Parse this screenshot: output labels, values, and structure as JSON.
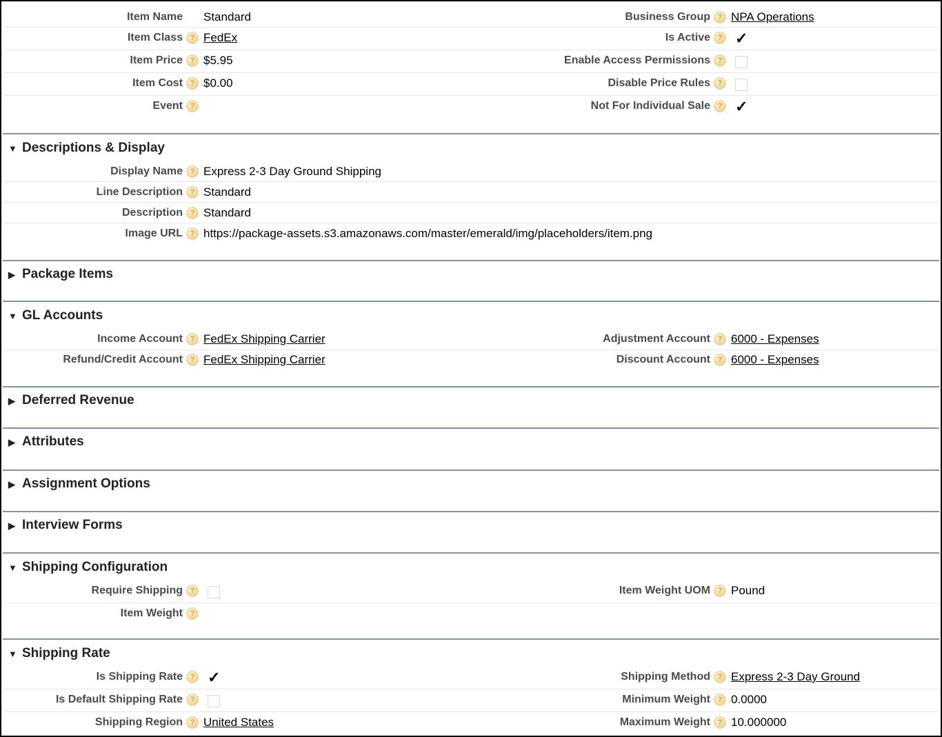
{
  "help_glyph": "?",
  "check_glyph": "✓",
  "triangle_expanded": "▼",
  "triangle_collapsed": "▶",
  "general": {
    "item_name_label": "Item Name",
    "item_name_value": "Standard",
    "item_class_label": "Item Class",
    "item_class_value": "FedEx",
    "item_price_label": "Item Price",
    "item_price_value": "$5.95",
    "item_cost_label": "Item Cost",
    "item_cost_value": "$0.00",
    "event_label": "Event",
    "business_group_label": "Business Group",
    "business_group_value": "NPA Operations",
    "is_active_label": "Is Active",
    "is_active_checked": true,
    "enable_access_label": "Enable Access Permissions",
    "enable_access_checked": false,
    "disable_price_rules_label": "Disable Price Rules",
    "disable_price_rules_checked": false,
    "not_individual_label": "Not For Individual Sale",
    "not_individual_checked": true
  },
  "descriptions": {
    "title": "Descriptions & Display",
    "display_name_label": "Display Name",
    "display_name_value": "Express 2-3 Day Ground Shipping",
    "line_description_label": "Line Description",
    "line_description_value": "Standard",
    "description_label": "Description",
    "description_value": "Standard",
    "image_url_label": "Image URL",
    "image_url_value": "https://package-assets.s3.amazonaws.com/master/emerald/img/placeholders/item.png"
  },
  "package_items": {
    "title": "Package Items"
  },
  "gl_accounts": {
    "title": "GL Accounts",
    "income_label": "Income Account",
    "income_value": "FedEx Shipping Carrier",
    "refund_label": "Refund/Credit Account",
    "refund_value": "FedEx Shipping Carrier",
    "adjustment_label": "Adjustment Account",
    "adjustment_value": "6000 - Expenses",
    "discount_label": "Discount Account",
    "discount_value": "6000 - Expenses"
  },
  "deferred_revenue": {
    "title": "Deferred Revenue"
  },
  "attributes": {
    "title": "Attributes"
  },
  "assignment_options": {
    "title": "Assignment Options"
  },
  "interview_forms": {
    "title": "Interview Forms"
  },
  "shipping_configuration": {
    "title": "Shipping Configuration",
    "require_shipping_label": "Require Shipping",
    "require_shipping_checked": false,
    "item_weight_label": "Item Weight",
    "item_weight_uom_label": "Item Weight UOM",
    "item_weight_uom_value": "Pound"
  },
  "shipping_rate": {
    "title": "Shipping Rate",
    "is_shipping_rate_label": "Is Shipping Rate",
    "is_shipping_rate_checked": true,
    "is_default_label": "Is Default Shipping Rate",
    "is_default_checked": false,
    "region_label": "Shipping Region",
    "region_value": "United States",
    "method_label": "Shipping Method",
    "method_value": "Express 2-3 Day Ground",
    "min_weight_label": "Minimum Weight",
    "min_weight_value": "0.0000",
    "max_weight_label": "Maximum Weight",
    "max_weight_value": "10.000000"
  }
}
